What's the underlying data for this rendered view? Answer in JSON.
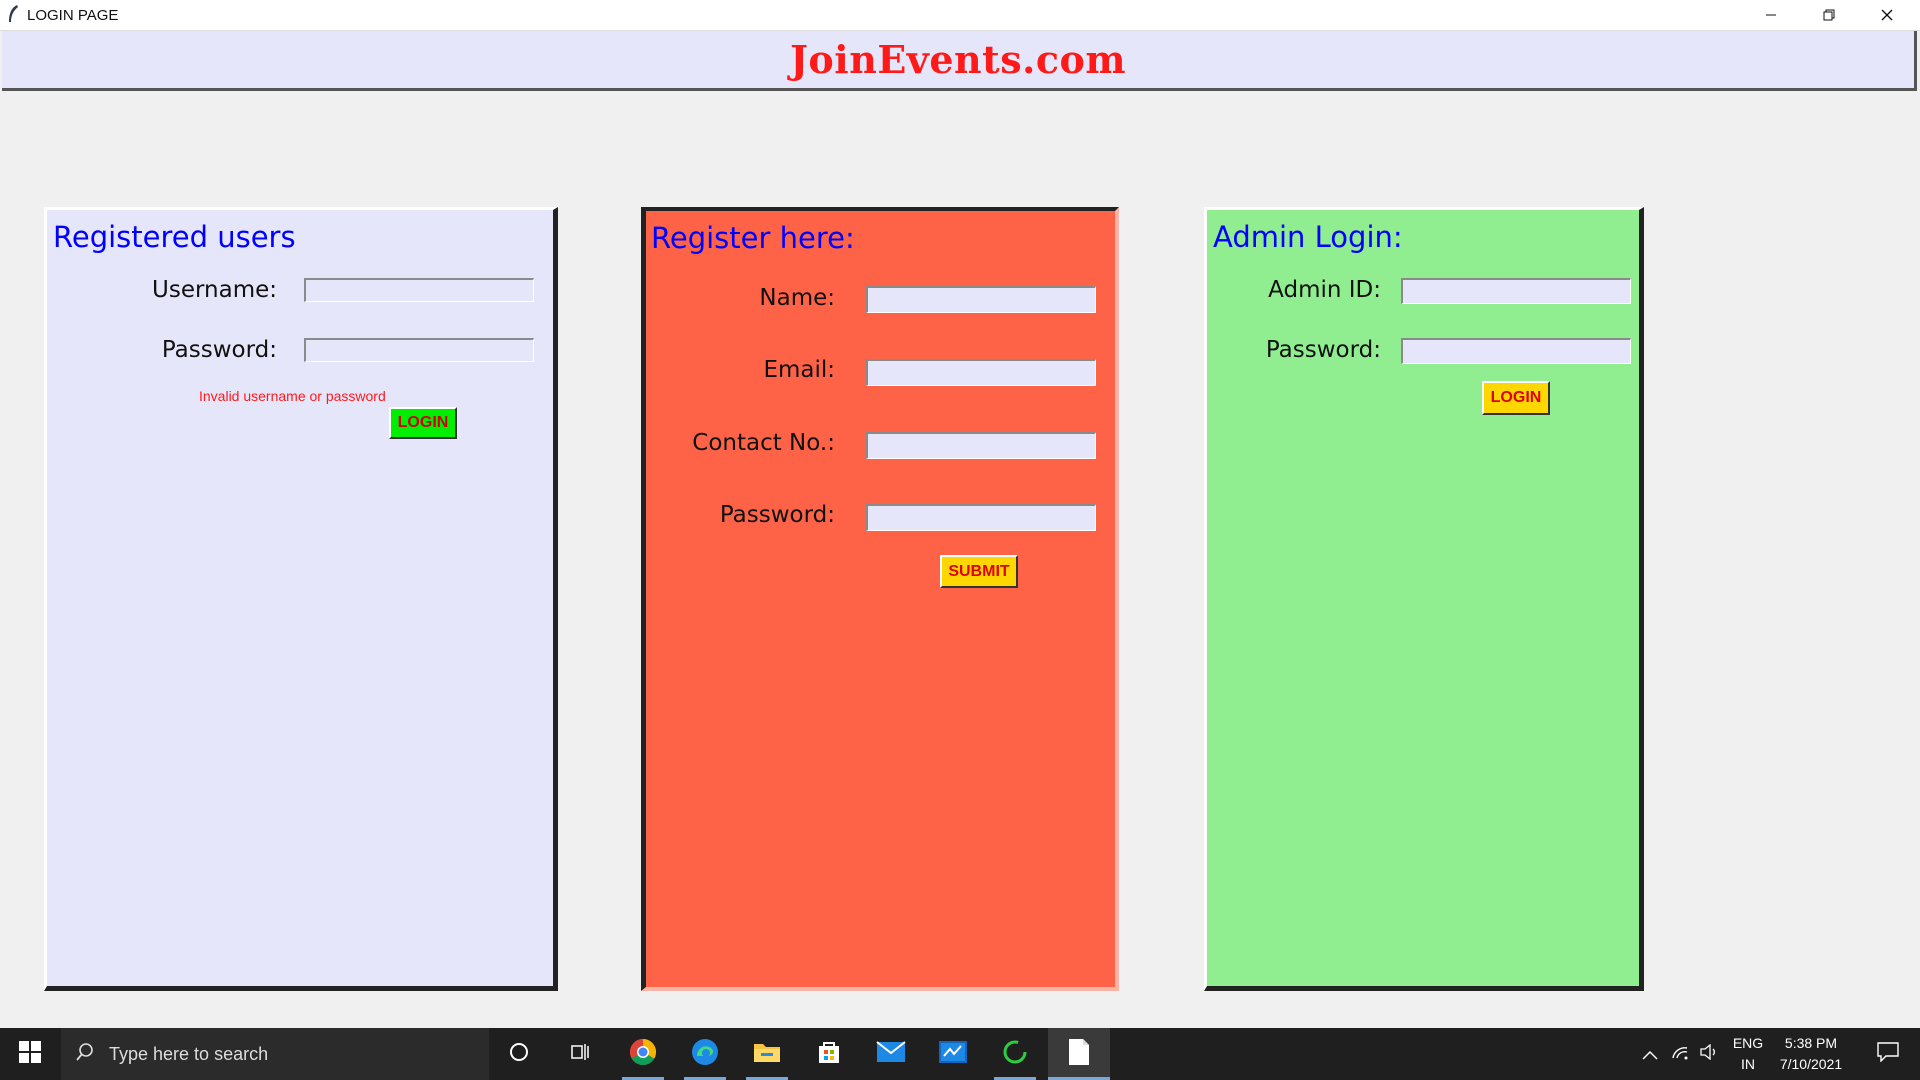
{
  "window": {
    "title": "LOGIN PAGE"
  },
  "header": {
    "brand": "JoinEvents.com"
  },
  "users_panel": {
    "title": "Registered users",
    "username_label": "Username:",
    "password_label": "Password:",
    "username_value": "",
    "password_value": "",
    "error": "Invalid username or password",
    "login_label": "LOGIN"
  },
  "register_panel": {
    "title": "Register here:",
    "name_label": "Name:",
    "email_label": "Email:",
    "contact_label": "Contact No.:",
    "password_label": "Password:",
    "name_value": "",
    "email_value": "",
    "contact_value": "",
    "password_value": "",
    "submit_label": "SUBMIT"
  },
  "admin_panel": {
    "title": "Admin Login:",
    "admin_id_label": "Admin ID:",
    "password_label": "Password:",
    "admin_id_value": "",
    "password_value": "",
    "login_label": "LOGIN"
  },
  "taskbar": {
    "search_placeholder": "Type here to search",
    "language": "ENG",
    "region": "IN",
    "time": "5:38 PM",
    "date": "7/10/2021"
  },
  "colors": {
    "brand": "#ff1a1a",
    "users_bg": "#e6e6fa",
    "register_bg": "#ff6347",
    "admin_bg": "#90ee90",
    "title_blue": "#0000ff",
    "login_green": "#00ee00",
    "button_yellow": "#ffd700"
  },
  "icons": [
    "feather-icon",
    "minimize-icon",
    "restore-icon",
    "close-icon",
    "windows-start-icon",
    "search-icon",
    "cortana-icon",
    "task-view-icon",
    "chrome-icon",
    "edge-icon",
    "file-explorer-icon",
    "store-icon",
    "mail-icon",
    "whiteboard-icon",
    "loading-ring-icon",
    "notepad-icon",
    "chevron-up-icon",
    "network-icon",
    "volume-icon",
    "notification-icon"
  ]
}
